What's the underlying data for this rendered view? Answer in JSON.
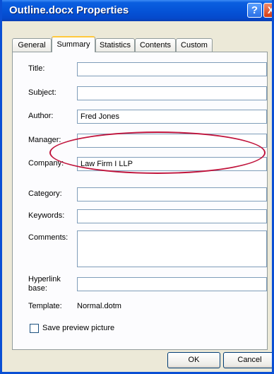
{
  "window": {
    "title": "Outline.docx Properties"
  },
  "titlebar_buttons": {
    "help": "?",
    "close": "X"
  },
  "tabs": [
    {
      "label": "General"
    },
    {
      "label": "Summary",
      "active": true
    },
    {
      "label": "Statistics"
    },
    {
      "label": "Contents"
    },
    {
      "label": "Custom"
    }
  ],
  "fields": {
    "title": {
      "label": "Title:",
      "value": ""
    },
    "subject": {
      "label": "Subject:",
      "value": ""
    },
    "author": {
      "label": "Author:",
      "value": "Fred Jones"
    },
    "manager": {
      "label": "Manager:",
      "value": ""
    },
    "company": {
      "label": "Company:",
      "value": "Law Firm I LLP"
    },
    "category": {
      "label": "Category:",
      "value": ""
    },
    "keywords": {
      "label": "Keywords:",
      "value": ""
    },
    "comments": {
      "label": "Comments:",
      "value": ""
    },
    "hyperlink": {
      "label_line1": "Hyperlink",
      "label_line2": "base:",
      "value": ""
    },
    "template": {
      "label": "Template:",
      "value": "Normal.dotm"
    }
  },
  "save_preview": {
    "label": "Save preview picture",
    "checked": false
  },
  "buttons": {
    "ok": "OK",
    "cancel": "Cancel"
  },
  "colors": {
    "titlebar": "#0552d6",
    "annotation_ellipse": "#c0143c",
    "active_tab_accent": "#ffc83c"
  }
}
